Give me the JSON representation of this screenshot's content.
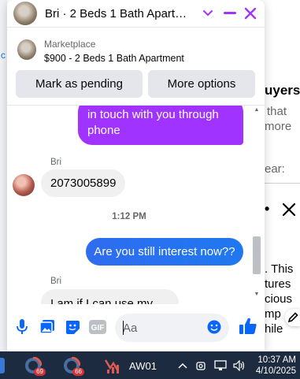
{
  "chat": {
    "title": "Bri · 2 Beds 1 Bath Apartm…",
    "listing": {
      "label": "Marketplace",
      "title": "$900 - 2 Beds 1 Bath Apartment"
    },
    "actions": {
      "mark_pending": "Mark as pending",
      "more_options": "More options"
    },
    "messages": [
      {
        "from": "me",
        "text": "in touch with you through\nphone",
        "line1": "in touch with you through",
        "line2": "phone"
      },
      {
        "from": "Bri",
        "sender": "Bri",
        "text": "2073005899"
      },
      {
        "timestamp": "1:12 PM"
      },
      {
        "from": "me",
        "text": "Are you still interest now??"
      },
      {
        "from": "Bri",
        "sender": "Bri",
        "text": "I am if I can use my"
      }
    ],
    "composer": {
      "placeholder": "Aa"
    }
  },
  "background": {
    "frag_uyers": "uyers",
    "frag_that": "that",
    "frag_more": "more",
    "frag_ear": "ear:",
    "frag_this": ". This",
    "frag_tures": "tures",
    "frag_cious": "cious",
    "frag_mp": "mp",
    "frag_hile": "hile",
    "frag_c": "c"
  },
  "taskbar": {
    "badge1": "69",
    "badge2": "66",
    "app_label": "AW01",
    "time": "10:37 AM",
    "date": "4/10/2025"
  },
  "colors": {
    "accent": "#a033ff",
    "outgoing": "#1f78f0",
    "like": "#0866ff",
    "taskbar": "#1c2b3f"
  }
}
